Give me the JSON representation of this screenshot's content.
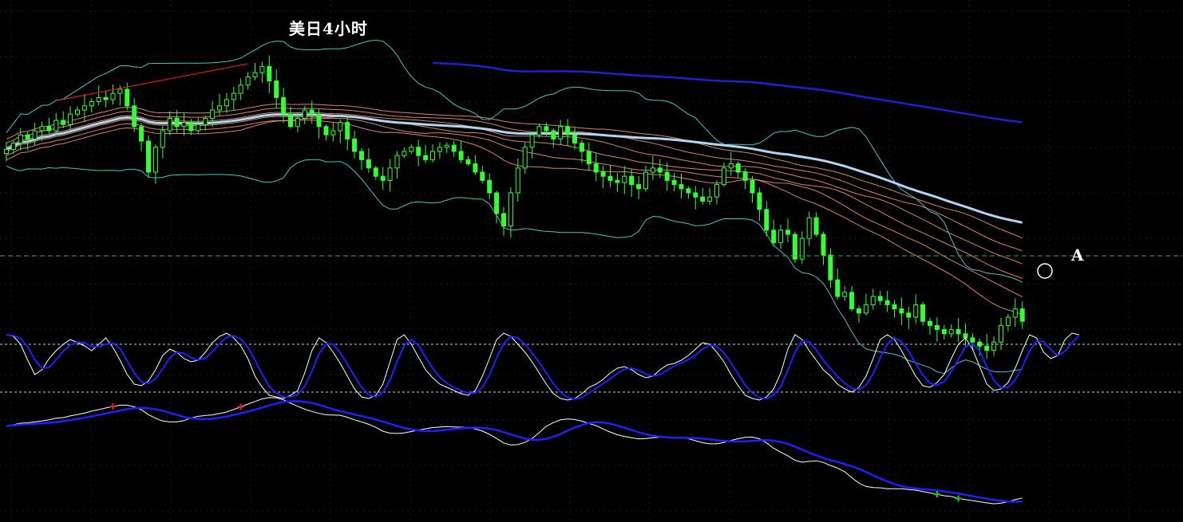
{
  "chart_data": {
    "type": "candlestick",
    "title": "美日4小时",
    "annotation": "A",
    "grid": true,
    "colors": {
      "background": "#000000",
      "candle": "#33ff33",
      "ma_fan": "#ff9a7a",
      "bollinger": "#3fc9c3",
      "slow_ma": "#aed6f0",
      "long_ma": "#1f1fd6",
      "trendline": "#e01b1b",
      "osc_fast": "#ffffff",
      "osc_slow": "#1f1fff",
      "level_line": "#44aa44",
      "up_arrow": "#22cc22",
      "down_arrow": "#ee2222"
    },
    "price_close": [
      51,
      54,
      58,
      56,
      60,
      62,
      60,
      65,
      63,
      68,
      70,
      72,
      74,
      76,
      75,
      78,
      80,
      72,
      62,
      55,
      40,
      52,
      60,
      66,
      62,
      64,
      60,
      63,
      66,
      70,
      72,
      75,
      78,
      82,
      86,
      88,
      91,
      84,
      76,
      68,
      62,
      66,
      70,
      68,
      62,
      58,
      60,
      64,
      56,
      50,
      46,
      42,
      38,
      36,
      42,
      48,
      50,
      52,
      48,
      46,
      50,
      52,
      53,
      50,
      46,
      44,
      40,
      36,
      30,
      20,
      14,
      30,
      42,
      52,
      58,
      62,
      60,
      56,
      62,
      58,
      54,
      50,
      44,
      40,
      38,
      36,
      35,
      38,
      34,
      32,
      40,
      42,
      40,
      36,
      34,
      32,
      30,
      28,
      26,
      28,
      34,
      42,
      44,
      40,
      36,
      30,
      22,
      12,
      6,
      12,
      10,
      -2,
      8,
      18,
      10,
      0,
      -12,
      -20,
      -18,
      -26,
      -28,
      -24,
      -20,
      -22,
      -24,
      -26,
      -28,
      -30,
      -24,
      -32,
      -34,
      -36,
      -38,
      -36,
      -38,
      -40,
      -42,
      -44,
      -46,
      -42,
      -34,
      -30,
      -26,
      -32
    ],
    "bollinger_ma_period": 20,
    "ma_fan_periods": [
      34,
      40,
      46,
      52,
      58,
      64
    ],
    "slow_ma_period": 90,
    "long_ma_period": 160,
    "osc_fast": [
      92,
      90,
      80,
      60,
      42,
      48,
      62,
      72,
      80,
      86,
      82,
      78,
      72,
      80,
      88,
      76,
      60,
      42,
      30,
      28,
      34,
      48,
      66,
      74,
      70,
      62,
      58,
      60,
      70,
      82,
      90,
      94,
      88,
      78,
      62,
      40,
      26,
      16,
      14,
      12,
      16,
      22,
      44,
      72,
      88,
      82,
      70,
      56,
      40,
      24,
      14,
      12,
      16,
      30,
      58,
      86,
      92,
      80,
      64,
      48,
      38,
      30,
      26,
      22,
      18,
      16,
      22,
      40,
      62,
      86,
      94,
      90,
      80,
      70,
      58,
      44,
      30,
      18,
      12,
      10,
      12,
      18,
      26,
      30,
      36,
      44,
      50,
      52,
      48,
      42,
      38,
      40,
      48,
      54,
      56,
      60,
      66,
      74,
      82,
      80,
      70,
      58,
      42,
      28,
      16,
      12,
      10,
      14,
      24,
      44,
      74,
      92,
      86,
      72,
      60,
      48,
      40,
      30,
      24,
      20,
      26,
      40,
      62,
      86,
      92,
      86,
      72,
      56,
      40,
      28,
      26,
      32,
      42,
      62,
      80,
      88,
      74,
      52,
      30,
      22,
      24,
      32,
      50,
      72,
      92,
      88,
      70,
      62,
      66,
      86,
      94,
      92
    ]
  }
}
